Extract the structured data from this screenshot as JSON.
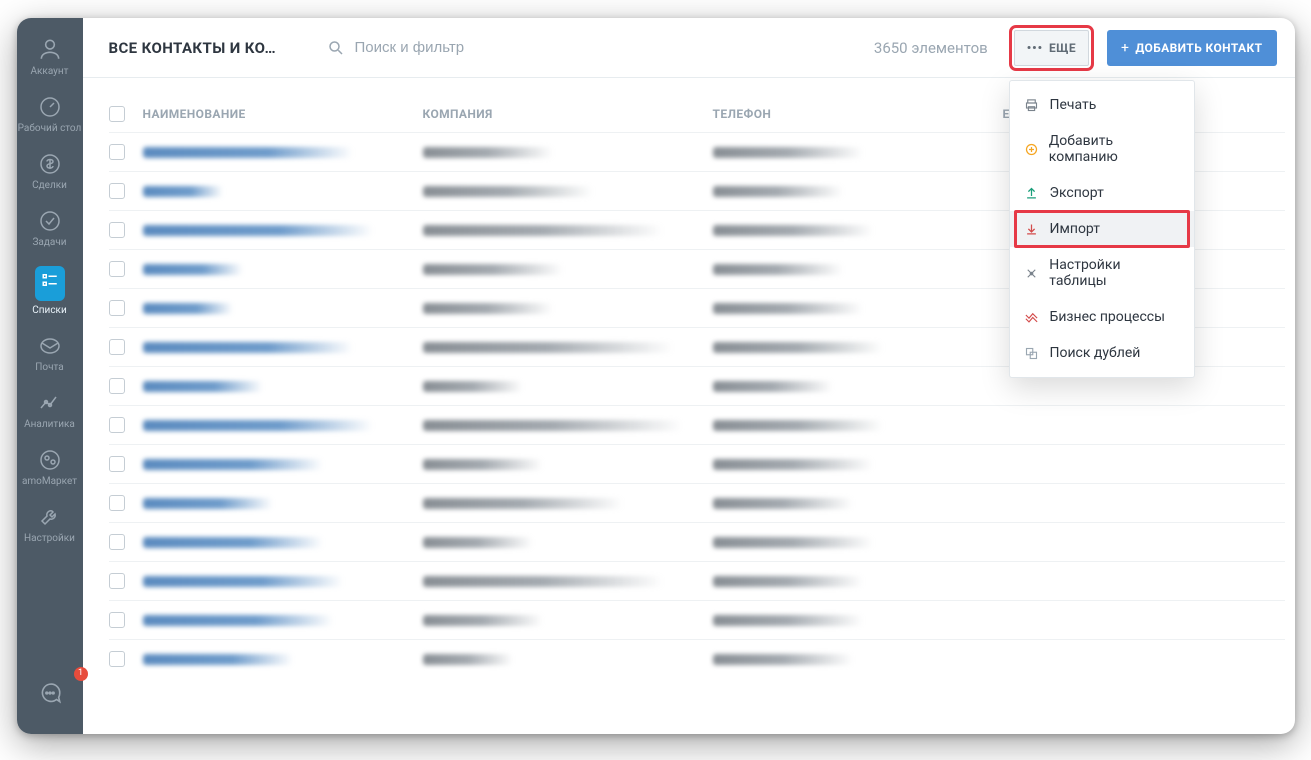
{
  "sidebar": {
    "items": [
      {
        "label": "Аккаунт"
      },
      {
        "label": "Рабочий стол"
      },
      {
        "label": "Сделки"
      },
      {
        "label": "Задачи"
      },
      {
        "label": "Списки"
      },
      {
        "label": "Почта"
      },
      {
        "label": "Аналитика"
      },
      {
        "label": "amoМаркет"
      },
      {
        "label": "Настройки"
      }
    ],
    "chat_badge": "1"
  },
  "header": {
    "title": "ВСЕ КОНТАКТЫ И КО…",
    "search_placeholder": "Поиск и фильтр",
    "count": "3650 элементов",
    "more_label": "ЕЩЕ",
    "add_label": "ДОБАВИТЬ КОНТАКТ"
  },
  "columns": {
    "name": "НАИМЕНОВАНИЕ",
    "company": "КОМПАНИЯ",
    "phone": "ТЕЛЕФОН",
    "email": "E"
  },
  "rows": [
    {
      "name_w": 210,
      "company_w": 130,
      "phone_w": 150
    },
    {
      "name_w": 80,
      "company_w": 170,
      "phone_w": 130
    },
    {
      "name_w": 230,
      "company_w": 240,
      "phone_w": 160
    },
    {
      "name_w": 100,
      "company_w": 140,
      "phone_w": 130
    },
    {
      "name_w": 90,
      "company_w": 130,
      "phone_w": 150
    },
    {
      "name_w": 210,
      "company_w": 250,
      "phone_w": 170
    },
    {
      "name_w": 120,
      "company_w": 100,
      "phone_w": 120
    },
    {
      "name_w": 230,
      "company_w": 260,
      "phone_w": 170
    },
    {
      "name_w": 180,
      "company_w": 120,
      "phone_w": 160
    },
    {
      "name_w": 130,
      "company_w": 200,
      "phone_w": 140
    },
    {
      "name_w": 180,
      "company_w": 110,
      "phone_w": 160
    },
    {
      "name_w": 200,
      "company_w": 240,
      "phone_w": 150
    },
    {
      "name_w": 190,
      "company_w": 120,
      "phone_w": 150
    },
    {
      "name_w": 150,
      "company_w": 90,
      "phone_w": 140
    }
  ],
  "dropdown": {
    "items": [
      {
        "icon": "printer",
        "label": "Печать"
      },
      {
        "icon": "add-company",
        "label": "Добавить компанию"
      },
      {
        "icon": "export",
        "label": "Экспорт"
      },
      {
        "icon": "import",
        "label": "Импорт"
      },
      {
        "icon": "settings",
        "label": "Настройки таблицы"
      },
      {
        "icon": "process",
        "label": "Бизнес процессы"
      },
      {
        "icon": "duplicates",
        "label": "Поиск дублей"
      }
    ]
  },
  "colors": {
    "accent": "#4f8fd7",
    "highlight": "#e63946"
  }
}
